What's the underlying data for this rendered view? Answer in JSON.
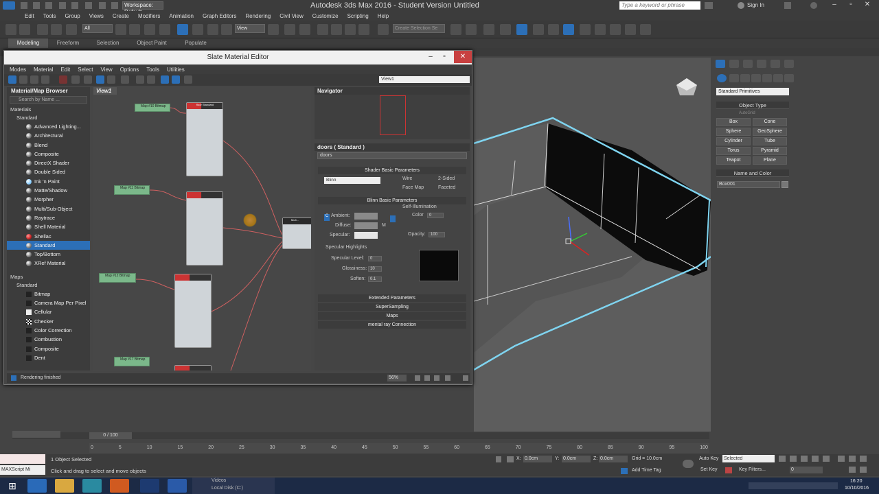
{
  "app": {
    "title": "Autodesk 3ds Max 2016 - Student Version   Untitled",
    "workspace": "Workspace: Default",
    "search_placeholder": "Type a keyword or phrase",
    "signin": "Sign In"
  },
  "menubar": [
    "Edit",
    "Tools",
    "Group",
    "Views",
    "Create",
    "Modifiers",
    "Animation",
    "Graph Editors",
    "Rendering",
    "Civil View",
    "Customize",
    "Scripting",
    "Help"
  ],
  "toolbar": {
    "selection_filter": "All",
    "ref_coord": "View",
    "named_selection": "Create Selection Se"
  },
  "ribbon": {
    "tabs": [
      "Modeling",
      "Freeform",
      "Selection",
      "Object Paint",
      "Populate"
    ]
  },
  "slate": {
    "title": "Slate Material Editor",
    "menu": [
      "Modes",
      "Material",
      "Edit",
      "Select",
      "View",
      "Options",
      "Tools",
      "Utilities"
    ],
    "view_select": "View1",
    "browser": {
      "title": "Material/Map Browser",
      "search": "Search by Name ...",
      "materials_group": "Materials",
      "standard_sub": "Standard",
      "materials": [
        "Advanced Lighting...",
        "Architectural",
        "Blend",
        "Composite",
        "DirectX Shader",
        "Double Sided",
        "Ink 'n Paint",
        "Matte/Shadow",
        "Morpher",
        "Multi/Sub-Object",
        "Raytrace",
        "Shell Material",
        "Shellac",
        "Standard",
        "Top/Bottom",
        "XRef Material"
      ],
      "maps_group": "Maps",
      "maps_sub": "Standard",
      "maps": [
        "Bitmap",
        "Camera Map Per Pixel",
        "Cellular",
        "Checker",
        "Color Correction",
        "Combustion",
        "Composite",
        "Dent"
      ]
    },
    "view_tab": "View1",
    "nodes": {
      "map1": "Map #10 Bitmap",
      "map2": "Map #11 Bitmap",
      "map3": "Map #12 Bitmap",
      "map4": "Map #17 Bitmap",
      "floor": "floor Standard",
      "multi": "Mult..."
    },
    "navigator": "Navigator",
    "param": {
      "header": "doors  ( Standard )",
      "name": "doors",
      "shader_basic": "Shader Basic Parameters",
      "shader": "Blinn",
      "wire": "Wire",
      "two_sided": "2-Sided",
      "face_map": "Face Map",
      "faceted": "Faceted",
      "blinn_basic": "Blinn Basic Parameters",
      "self_illum": "Self-Illumination",
      "color_label": "Color",
      "color_val": "0",
      "ambient": "Ambient:",
      "diffuse": "Diffuse:",
      "specular": "Specular:",
      "m": "M",
      "c": "C",
      "opacity_label": "Opacity:",
      "opacity_val": "100",
      "spec_highlights": "Specular Highlights",
      "spec_level_label": "Specular Level:",
      "spec_level_val": "0",
      "gloss_label": "Glossiness:",
      "gloss_val": "10",
      "soften_label": "Soften:",
      "soften_val": "0.1",
      "rollouts": [
        "Extended Parameters",
        "SuperSampling",
        "Maps",
        "mental ray Connection"
      ]
    },
    "status": "Rendering finished",
    "zoom": "56%"
  },
  "command_panel": {
    "category": "Standard Primitives",
    "object_type": "Object Type",
    "autogrid": "AutoGrid",
    "buttons": [
      "Box",
      "Cone",
      "Sphere",
      "GeoSphere",
      "Cylinder",
      "Tube",
      "Torus",
      "Pyramid",
      "Teapot",
      "Plane"
    ],
    "name_color": "Name and Color",
    "object_name": "Box001"
  },
  "timeline": {
    "frame": "0 / 100",
    "ticks": [
      "0",
      "5",
      "10",
      "15",
      "20",
      "25",
      "30",
      "35",
      "40",
      "45",
      "50",
      "55",
      "60",
      "65",
      "70",
      "75",
      "80",
      "85",
      "90",
      "95",
      "100"
    ]
  },
  "status": {
    "selected": "1 Object Selected",
    "prompt": "Click and drag to select and move objects",
    "maxscript": "MAXScript Mi",
    "x_label": "X:",
    "x_val": "0.0cm",
    "y_label": "Y:",
    "y_val": "0.0cm",
    "z_label": "Z:",
    "z_val": "0.0cm",
    "grid": "Grid = 10.0cm",
    "add_time_tag": "Add Time Tag",
    "auto_key": "Auto Key",
    "set_key": "Set Key",
    "selected_dd": "Selected",
    "key_filters": "Key Filters...",
    "frame_field": "0"
  },
  "taskbar": {
    "tooltip1": "Videos",
    "tooltip2": "Local Disk (C:)",
    "time": "16:20",
    "date": "10/10/2016"
  },
  "colors": {
    "accent": "#2c6fb7",
    "wire_cyan": "#7fd4f0",
    "node_red": "#c33333",
    "map_green": "#7bb88a"
  }
}
